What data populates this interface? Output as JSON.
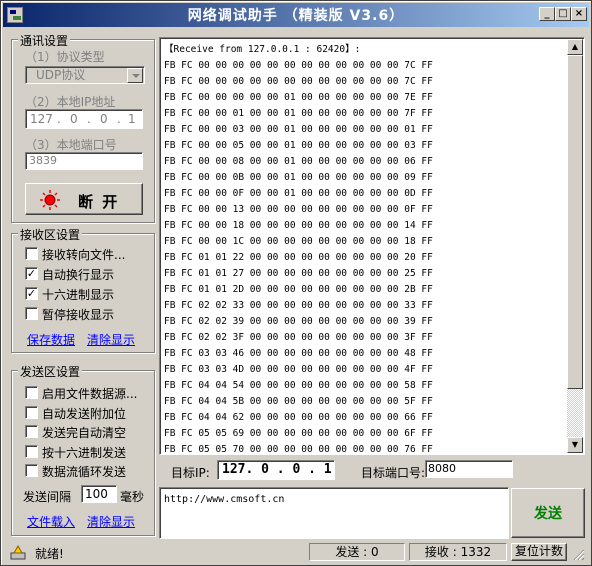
{
  "title": "网络调试助手 （精装版 V3.6）",
  "window_buttons": {
    "minimize": "_",
    "maximize": "□",
    "close": "×"
  },
  "comm": {
    "group_title": "通讯设置",
    "protocol_label": "（1）协议类型",
    "protocol_value": "UDP协议",
    "ip_label": "（2）本地IP地址",
    "ip_segments": [
      "127",
      "0",
      "0",
      "1"
    ],
    "port_label": "（3）本地端口号",
    "port_value": "3839",
    "disconnect_label": "断 开"
  },
  "receive": {
    "group_title": "接收区设置",
    "options": [
      {
        "label": "接收转向文件...",
        "checked": false
      },
      {
        "label": "自动换行显示",
        "checked": true
      },
      {
        "label": "十六进制显示",
        "checked": true
      },
      {
        "label": "暂停接收显示",
        "checked": false
      }
    ],
    "save_label": "保存数据",
    "clear_label": "清除显示"
  },
  "send": {
    "group_title": "发送区设置",
    "options": [
      {
        "label": "启用文件数据源...",
        "checked": false
      },
      {
        "label": "自动发送附加位",
        "checked": false
      },
      {
        "label": "发送完自动清空",
        "checked": false
      },
      {
        "label": "按十六进制发送",
        "checked": false
      },
      {
        "label": "数据流循环发送",
        "checked": false
      }
    ],
    "interval_label": "发送间隔",
    "interval_value": "100",
    "interval_unit": "毫秒",
    "load_file_label": "文件载入",
    "clear_label": "清除显示"
  },
  "received_lines": [
    "【Receive from 127.0.0.1 : 62420】:",
    "FB FC 00 00 00 00 00 00 00 00 00 00 00 00 7C FF",
    "FB FC 00 00 00 00 00 00 00 00 00 00 00 00 7C FF",
    "FB FC 00 00 00 00 00 01 00 00 00 00 00 00 7E FF",
    "FB FC 00 00 01 00 00 01 00 00 00 00 00 00 7F FF",
    "FB FC 00 00 03 00 00 01 00 00 00 00 00 00 01 FF",
    "FB FC 00 00 05 00 00 01 00 00 00 00 00 00 03 FF",
    "FB FC 00 00 08 00 00 01 00 00 00 00 00 00 06 FF",
    "FB FC 00 00 0B 00 00 01 00 00 00 00 00 00 09 FF",
    "FB FC 00 00 0F 00 00 01 00 00 00 00 00 00 0D FF",
    "FB FC 00 00 13 00 00 00 00 00 00 00 00 00 0F FF",
    "FB FC 00 00 18 00 00 00 00 00 00 00 00 00 14 FF",
    "FB FC 00 00 1C 00 00 00 00 00 00 00 00 00 18 FF",
    "FB FC 01 01 22 00 00 00 00 00 00 00 00 00 20 FF",
    "FB FC 01 01 27 00 00 00 00 00 00 00 00 00 25 FF",
    "FB FC 01 01 2D 00 00 00 00 00 00 00 00 00 2B FF",
    "FB FC 02 02 33 00 00 00 00 00 00 00 00 00 33 FF",
    "FB FC 02 02 39 00 00 00 00 00 00 00 00 00 39 FF",
    "FB FC 02 02 3F 00 00 00 00 00 00 00 00 00 3F FF",
    "FB FC 03 03 46 00 00 00 00 00 00 00 00 00 48 FF",
    "FB FC 03 03 4D 00 00 00 00 00 00 00 00 00 4F FF",
    "FB FC 04 04 54 00 00 00 00 00 00 00 00 00 58 FF",
    "FB FC 04 04 5B 00 00 00 00 00 00 00 00 00 5F FF",
    "FB FC 04 04 62 00 00 00 00 00 00 00 00 00 66 FF",
    "FB FC 05 05 69 00 00 00 00 00 00 00 00 00 6F FF",
    "FB FC 05 05 70 00 00 00 00 00 00 00 00 00 76 FF"
  ],
  "target": {
    "ip_label": "目标IP:",
    "ip_value": "127. 0 . 0 . 1",
    "port_label": "目标端口号:",
    "port_value": "8080"
  },
  "send_text": "http://www.cmsoft.cn",
  "send_button": "发送",
  "status": {
    "ready": "就绪!",
    "sent": "发送 : 0",
    "received": "接收 : 1332",
    "reset": "复位计数"
  },
  "colors": {
    "titlebar_start": "#0a246a",
    "titlebar_end": "#a6caf0",
    "link": "#0000ff",
    "send_button_text": "#008000",
    "disconnect_icon": "#ff0000"
  }
}
